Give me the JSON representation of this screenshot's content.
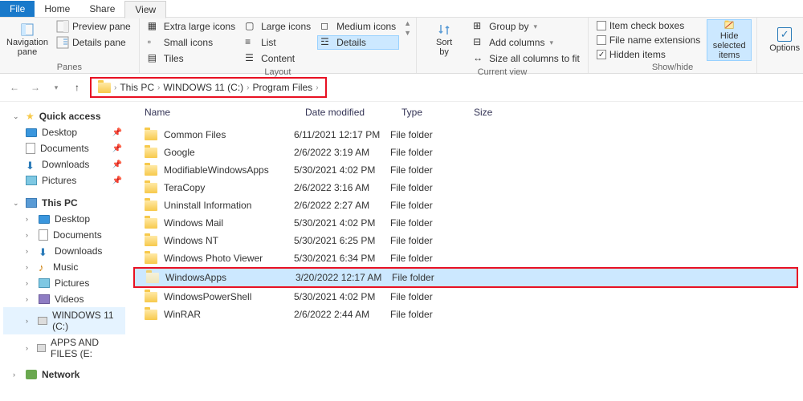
{
  "tabs": {
    "file": "File",
    "home": "Home",
    "share": "Share",
    "view": "View"
  },
  "ribbon": {
    "panes": {
      "title": "Panes",
      "nav": "Navigation\npane",
      "preview": "Preview pane",
      "details": "Details pane"
    },
    "layout": {
      "title": "Layout",
      "xl": "Extra large icons",
      "lg": "Large icons",
      "md": "Medium icons",
      "sm": "Small icons",
      "list": "List",
      "details": "Details",
      "tiles": "Tiles",
      "content": "Content"
    },
    "currentview": {
      "title": "Current view",
      "sort": "Sort\nby",
      "group": "Group by",
      "addcols": "Add columns",
      "sizecols": "Size all columns to fit"
    },
    "showhide": {
      "title": "Show/hide",
      "itemcheck": "Item check boxes",
      "ext": "File name extensions",
      "hidden": "Hidden items",
      "hidesel": "Hide selected\nitems"
    },
    "options": "Options"
  },
  "breadcrumb": [
    "This PC",
    "WINDOWS 11 (C:)",
    "Program Files"
  ],
  "sidebar": {
    "quick": "Quick access",
    "quick_items": [
      {
        "label": "Desktop",
        "pinned": true
      },
      {
        "label": "Documents",
        "pinned": true
      },
      {
        "label": "Downloads",
        "pinned": true
      },
      {
        "label": "Pictures",
        "pinned": true
      }
    ],
    "thispc": "This PC",
    "pc_items": [
      {
        "label": "Desktop"
      },
      {
        "label": "Documents"
      },
      {
        "label": "Downloads"
      },
      {
        "label": "Music"
      },
      {
        "label": "Pictures"
      },
      {
        "label": "Videos"
      },
      {
        "label": "WINDOWS 11 (C:)"
      },
      {
        "label": "APPS AND FILES (E:"
      }
    ],
    "network": "Network"
  },
  "columns": {
    "name": "Name",
    "date": "Date modified",
    "type": "Type",
    "size": "Size"
  },
  "rows": [
    {
      "name": "Common Files",
      "date": "6/11/2021 12:17 PM",
      "type": "File folder"
    },
    {
      "name": "Google",
      "date": "2/6/2022 3:19 AM",
      "type": "File folder"
    },
    {
      "name": "ModifiableWindowsApps",
      "date": "5/30/2021 4:02 PM",
      "type": "File folder"
    },
    {
      "name": "TeraCopy",
      "date": "2/6/2022 3:16 AM",
      "type": "File folder"
    },
    {
      "name": "Uninstall Information",
      "date": "2/6/2022 2:27 AM",
      "type": "File folder"
    },
    {
      "name": "Windows Mail",
      "date": "5/30/2021 4:02 PM",
      "type": "File folder"
    },
    {
      "name": "Windows NT",
      "date": "5/30/2021 6:25 PM",
      "type": "File folder"
    },
    {
      "name": "Windows Photo Viewer",
      "date": "5/30/2021 6:34 PM",
      "type": "File folder"
    },
    {
      "name": "WindowsApps",
      "date": "3/20/2022 12:17 AM",
      "type": "File folder",
      "selected": true,
      "pale": true
    },
    {
      "name": "WindowsPowerShell",
      "date": "5/30/2021 4:02 PM",
      "type": "File folder"
    },
    {
      "name": "WinRAR",
      "date": "2/6/2022 2:44 AM",
      "type": "File folder"
    }
  ]
}
